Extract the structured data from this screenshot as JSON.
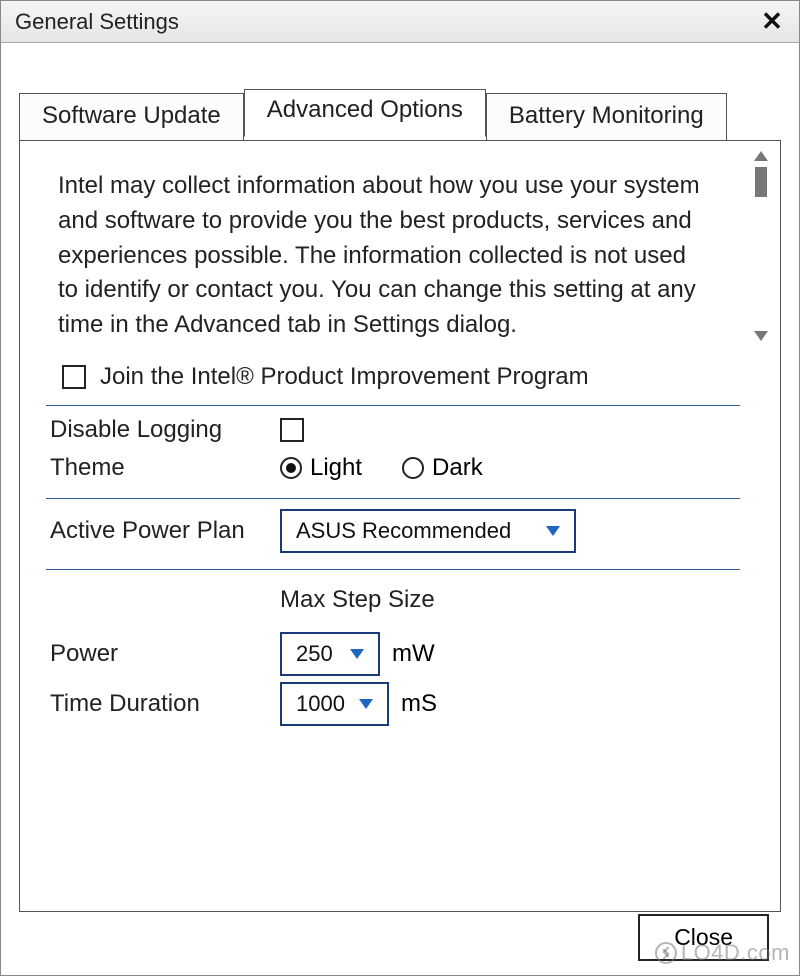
{
  "window": {
    "title": "General Settings"
  },
  "tabs": {
    "software_update": "Software Update",
    "advanced_options": "Advanced Options",
    "battery_monitoring": "Battery Monitoring"
  },
  "info_text": "Intel may collect information about how you use your system and software to provide you the best products, services and experiences possible. The information collected is not used to identify or contact you. You can change this setting at any time in the Advanced tab in Settings dialog.",
  "join_program": {
    "label": "Join the Intel® Product Improvement Program",
    "checked": false
  },
  "disable_logging": {
    "label": "Disable Logging",
    "checked": false
  },
  "theme": {
    "label": "Theme",
    "light": "Light",
    "dark": "Dark",
    "selected": "light"
  },
  "power_plan": {
    "label": "Active Power Plan",
    "value": "ASUS Recommended"
  },
  "max_step": {
    "header": "Max Step Size",
    "power": {
      "label": "Power",
      "value": "250",
      "unit": "mW"
    },
    "time": {
      "label": "Time Duration",
      "value": "1000",
      "unit": "mS"
    }
  },
  "buttons": {
    "close": "Close"
  },
  "watermark": "LO4D.com"
}
